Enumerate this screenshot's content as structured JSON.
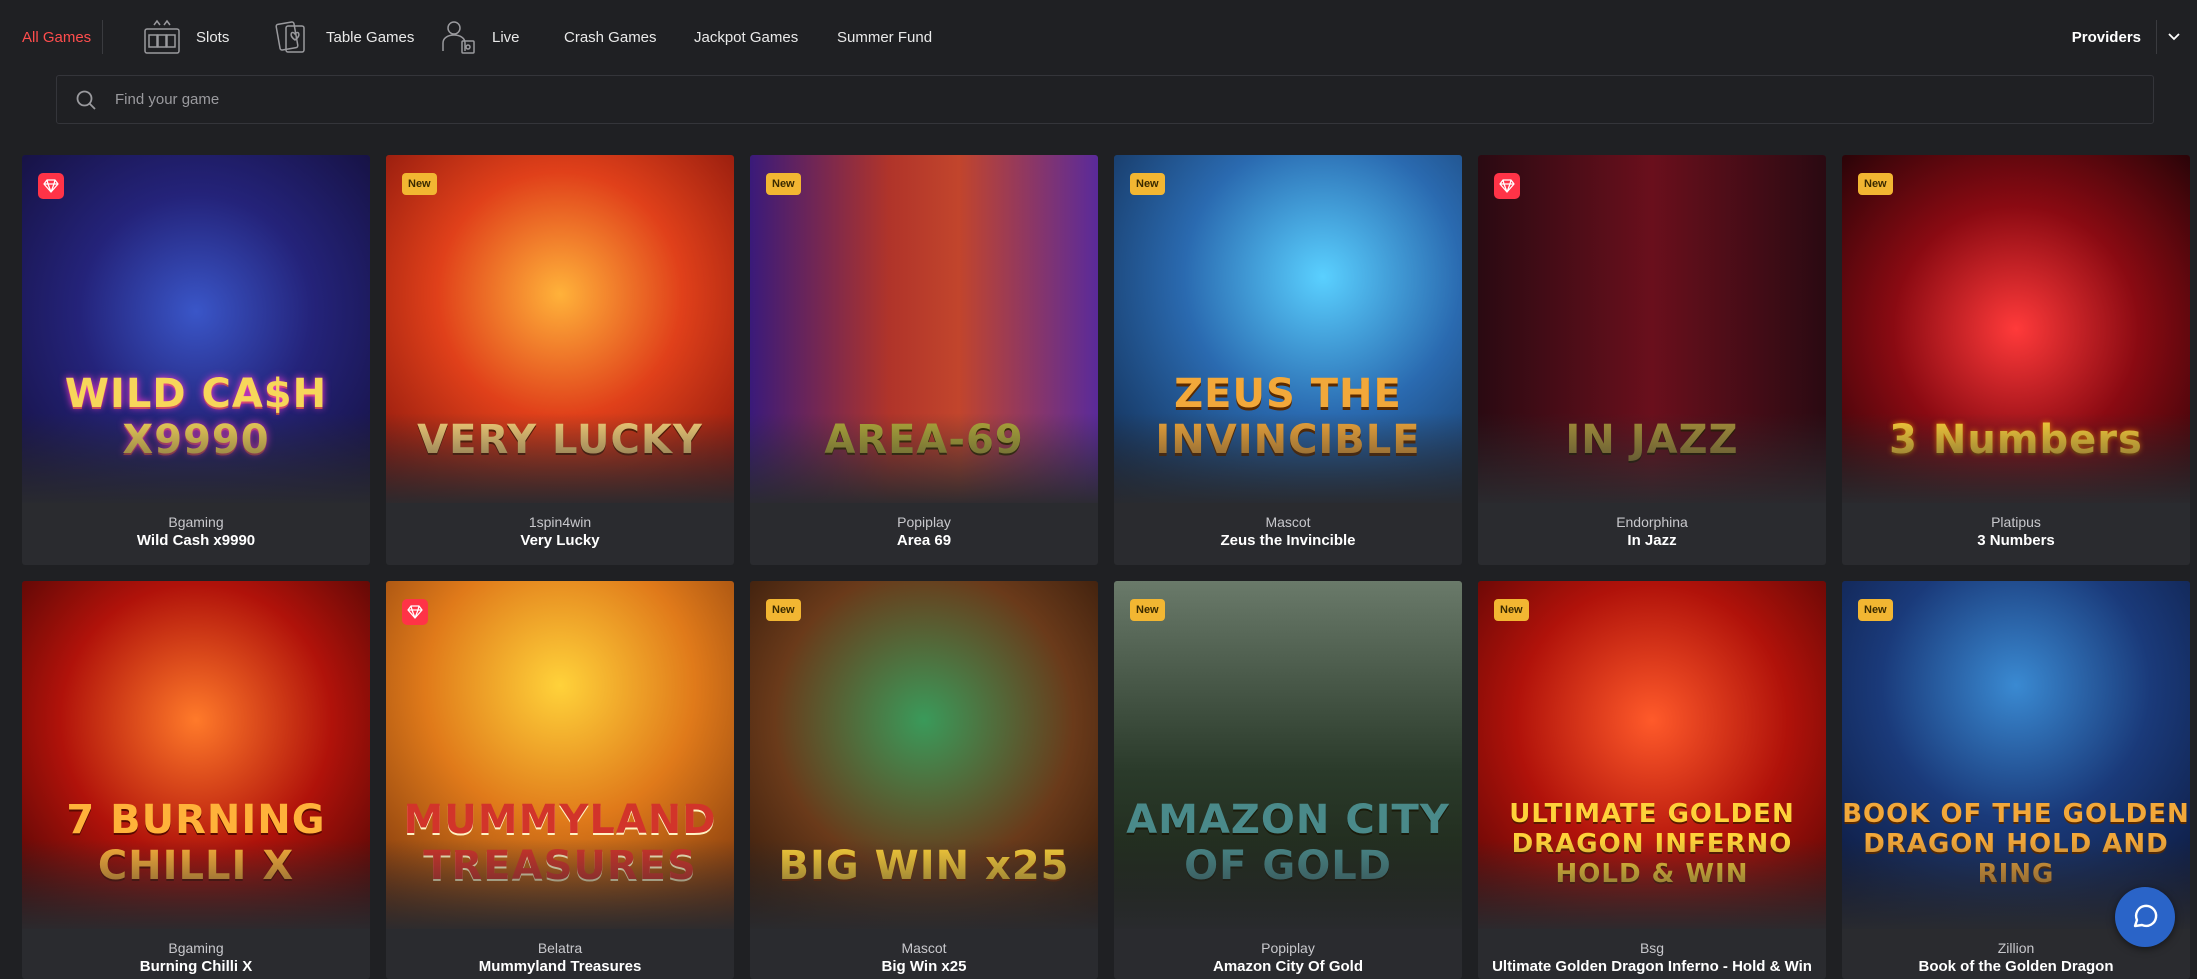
{
  "nav": {
    "all_games": "All Games",
    "items": [
      {
        "label": "Slots",
        "icon": "slot-machine-icon"
      },
      {
        "label": "Table Games",
        "icon": "playing-cards-icon"
      },
      {
        "label": "Live",
        "icon": "live-dealer-icon"
      },
      {
        "label": "Crash Games",
        "icon": ""
      },
      {
        "label": "Jackpot Games",
        "icon": ""
      },
      {
        "label": "Summer Fund",
        "icon": ""
      }
    ],
    "providers_label": "Providers"
  },
  "search": {
    "placeholder": "Find your game"
  },
  "colors": {
    "accent": "#ff4d4d",
    "new_badge": "#f2b632",
    "gem_badge": "#ff3347",
    "chat": "#2a64c8"
  },
  "games": [
    {
      "provider": "Bgaming",
      "name": "Wild Cash x9990",
      "badge": "gem",
      "art": "WILD CA$H X9990"
    },
    {
      "provider": "1spin4win",
      "name": "Very Lucky",
      "badge": "New",
      "art": "VERY LUCKY"
    },
    {
      "provider": "Popiplay",
      "name": "Area 69",
      "badge": "New",
      "art": "AREA-69"
    },
    {
      "provider": "Mascot",
      "name": "Zeus the Invincible",
      "badge": "New",
      "art": "ZEUS THE INVINCIBLE"
    },
    {
      "provider": "Endorphina",
      "name": "In Jazz",
      "badge": "gem",
      "art": "IN JAZZ"
    },
    {
      "provider": "Platipus",
      "name": "3 Numbers",
      "badge": "New",
      "art": "3 Numbers"
    },
    {
      "provider": "Bgaming",
      "name": "Burning Chilli X",
      "badge": "",
      "art": "7 BURNING CHILLI X"
    },
    {
      "provider": "Belatra",
      "name": "Mummyland Treasures",
      "badge": "gem",
      "art": "MUMMYLAND TREASURES"
    },
    {
      "provider": "Mascot",
      "name": "Big Win x25",
      "badge": "New",
      "art": "BIG WIN x25"
    },
    {
      "provider": "Popiplay",
      "name": "Amazon City Of Gold",
      "badge": "New",
      "art": "AMAZON CITY OF GOLD"
    },
    {
      "provider": "Bsg",
      "name": "Ultimate Golden Dragon Inferno - Hold & Win",
      "badge": "New",
      "art": "ULTIMATE GOLDEN DRAGON INFERNO HOLD & WIN"
    },
    {
      "provider": "Zillion",
      "name": "Book of the Golden Dragon",
      "badge": "New",
      "art": "BOOK OF THE GOLDEN DRAGON HOLD AND RING"
    }
  ]
}
